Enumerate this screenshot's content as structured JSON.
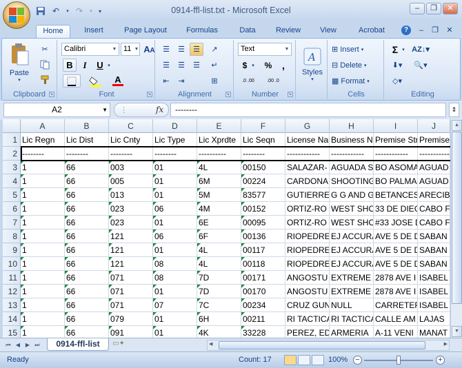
{
  "window": {
    "title": "0914-ffl-list.txt - Microsoft Excel"
  },
  "window_buttons": [
    "–",
    "❐",
    "✕"
  ],
  "tabs": [
    "Home",
    "Insert",
    "Page Layout",
    "Formulas",
    "Data",
    "Review",
    "View",
    "Acrobat"
  ],
  "ribbon": {
    "clipboard": {
      "label": "Clipboard",
      "paste": "Paste"
    },
    "font": {
      "label": "Font",
      "name": "Calibri",
      "size": "11",
      "bold": "B",
      "italic": "I",
      "underline": "U",
      "grow": "A",
      "shrink": "A",
      "color": "A"
    },
    "alignment": {
      "label": "Alignment"
    },
    "number": {
      "label": "Number",
      "format": "Text",
      "currency": "$",
      "percent": "%",
      "comma": ",",
      "inc": ".0 .00",
      "dec": ".00 .0"
    },
    "styles": {
      "label": "Styles"
    },
    "cells": {
      "label": "Cells",
      "insert": "Insert",
      "delete": "Delete",
      "format": "Format"
    },
    "editing": {
      "label": "Editing",
      "sum": "Σ"
    }
  },
  "formula_bar": {
    "name_box": "A2",
    "fx": "fx",
    "content": "--------"
  },
  "columns": [
    "A",
    "B",
    "C",
    "D",
    "E",
    "F",
    "G",
    "H",
    "I",
    "J"
  ],
  "rows": [
    [
      "Lic Regn",
      "Lic Dist",
      "Lic Cnty",
      "Lic Type",
      "Lic Xprdte",
      "Lic Seqn",
      "License Name",
      "Business Name",
      "Premise Street",
      "Premise City"
    ],
    [
      "--------",
      "--------",
      "--------",
      "--------",
      "----------",
      "--------",
      "------------",
      "------------",
      "------------",
      "------------"
    ],
    [
      "1",
      "66",
      "003",
      "01",
      "4L",
      "00150",
      "SALAZAR-",
      "AGUADA S",
      "BO ASOMA",
      "AGUAD"
    ],
    [
      "1",
      "66",
      "005",
      "01",
      "6M",
      "00224",
      "CARDONA",
      "SHOOTING",
      "BO PALMA",
      "AGUAD"
    ],
    [
      "1",
      "66",
      "013",
      "01",
      "5M",
      "83577",
      "GUTIERRE",
      "G G AND G",
      "BETANCES",
      "ARECIB"
    ],
    [
      "1",
      "66",
      "023",
      "06",
      "4M",
      "00152",
      "ORTIZ-RO",
      "WEST SHO",
      "33 DE DIEG",
      "CABO F"
    ],
    [
      "1",
      "66",
      "023",
      "01",
      "6E",
      "00095",
      "ORTIZ-RO",
      "WEST SHO",
      "#33 JOSE D",
      "CABO F"
    ],
    [
      "1",
      "66",
      "121",
      "06",
      "6F",
      "00136",
      "RIOPEDRE",
      "EJ ACCURA",
      "AVE 5 DE D",
      "SABAN"
    ],
    [
      "1",
      "66",
      "121",
      "01",
      "4L",
      "00117",
      "RIOPEDRE",
      "EJ ACCURA",
      "AVE 5 DE D",
      "SABAN"
    ],
    [
      "1",
      "66",
      "121",
      "08",
      "4L",
      "00118",
      "RIOPEDRE",
      "EJ ACCURA",
      "AVE 5 DE D",
      "SABAN"
    ],
    [
      "1",
      "66",
      "071",
      "08",
      "7D",
      "00171",
      "ANGOSTU",
      "EXTREME A",
      "2878 AVE I",
      "ISABEL"
    ],
    [
      "1",
      "66",
      "071",
      "01",
      "7D",
      "00170",
      "ANGOSTU",
      "EXTREME A",
      "2878 AVE I",
      "ISABEL"
    ],
    [
      "1",
      "66",
      "071",
      "07",
      "7C",
      "00234",
      "CRUZ GUN",
      "NULL",
      "CARRETER",
      "ISABEL"
    ],
    [
      "1",
      "66",
      "079",
      "01",
      "6H",
      "00211",
      "RI TACTICA",
      "RI TACTICA",
      "CALLE AM",
      "LAJAS"
    ],
    [
      "1",
      "66",
      "091",
      "01",
      "4K",
      "33228",
      "PEREZ, ED",
      "ARMERIA",
      "A-11 VENI",
      "MANAT"
    ]
  ],
  "sheet": {
    "tab": "0914-ffl-list"
  },
  "status": {
    "ready": "Ready",
    "count": "Count: 17",
    "zoom": "100%"
  }
}
